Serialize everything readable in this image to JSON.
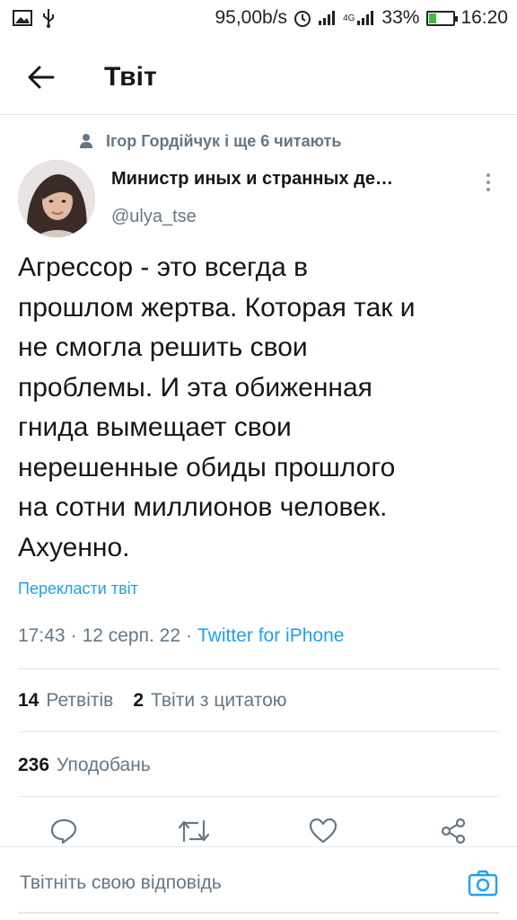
{
  "status_bar": {
    "speed": "95,00b/s",
    "network": "4G",
    "battery": "33%",
    "time": "16:20"
  },
  "header": {
    "title": "Твіт"
  },
  "tweet": {
    "social_context": "Ігор Гордійчук і ще 6 читають",
    "author_name": "Министр иных и странных де…",
    "author_handle": "@ulya_tse",
    "text": "Агрессор - это всегда в\nпрошлом жертва. Которая так и\nне смогла решить свои\nпроблемы. И эта обиженная\nгнида вымещает свои\nнерешенные обиды прошлого\nна сотни миллионов человек.\nАхуенно.",
    "translate_label": "Перекласти твіт",
    "time": "17:43",
    "dot1": "·",
    "date": "12 серп. 22",
    "dot2": "·",
    "source": "Twitter for iPhone"
  },
  "stats": {
    "retweets_count": "14",
    "retweets_label": "Ретвітів",
    "quotes_count": "2",
    "quotes_label": "Твіти з цитатою",
    "likes_count": "236",
    "likes_label": "Уподобань"
  },
  "actions": {
    "reply_icon": "reply-icon",
    "retweet_icon": "retweet-icon",
    "like_icon": "heart-icon",
    "share_icon": "share-icon"
  },
  "reply": {
    "placeholder": "Твітніть свою відповідь",
    "camera_icon": "camera-icon"
  },
  "colors": {
    "accent": "#1da1f2",
    "secondary_text": "#657786",
    "primary_text": "#14171a"
  }
}
